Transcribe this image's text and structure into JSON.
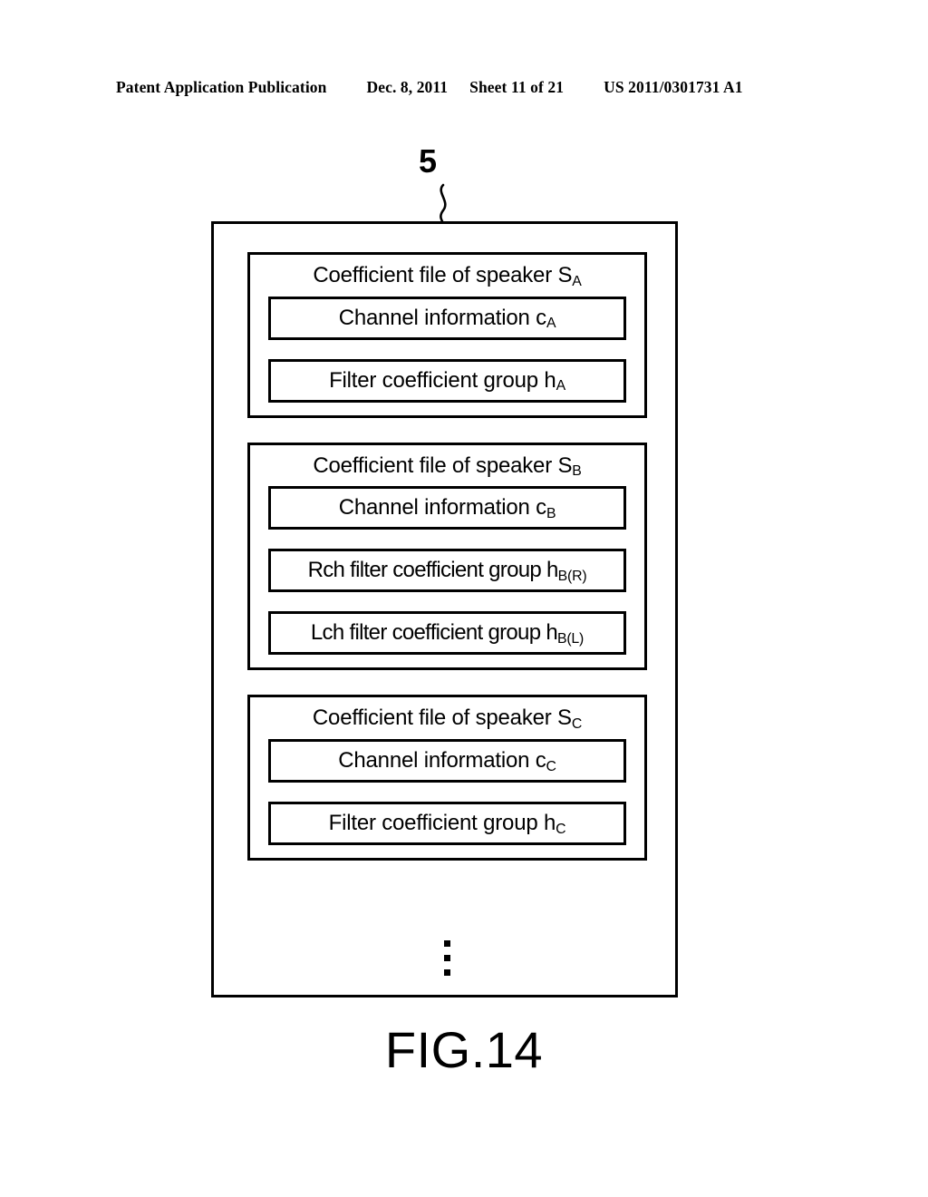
{
  "header": {
    "publication": "Patent Application Publication",
    "date": "Dec. 8, 2011",
    "sheet": "Sheet 11 of 21",
    "patent_number": "US 2011/0301731 A1"
  },
  "figure": {
    "reference_numeral": "5",
    "caption": "FIG.14",
    "ellipsis_label": "vertical-ellipsis-more-files"
  },
  "storage": {
    "blocks": [
      {
        "title_prefix": "Coefficient file of speaker S",
        "title_sub": "A",
        "fields": [
          {
            "prefix": "Channel information c",
            "sub": "A"
          },
          {
            "prefix": "Filter coefficient group h",
            "sub": "A"
          }
        ]
      },
      {
        "title_prefix": "Coefficient file of speaker S",
        "title_sub": "B",
        "fields": [
          {
            "prefix": "Channel information c",
            "sub": "B"
          },
          {
            "prefix": "Rch filter coefficient group h",
            "sub": "B(R)"
          },
          {
            "prefix": "Lch filter coefficient group h",
            "sub": "B(L)"
          }
        ]
      },
      {
        "title_prefix": "Coefficient file of speaker S",
        "title_sub": "C",
        "fields": [
          {
            "prefix": "Channel information c",
            "sub": "C"
          },
          {
            "prefix": "Filter coefficient group h",
            "sub": "C"
          }
        ]
      }
    ]
  },
  "colors": {
    "ink": "#000000",
    "paper": "#ffffff"
  }
}
